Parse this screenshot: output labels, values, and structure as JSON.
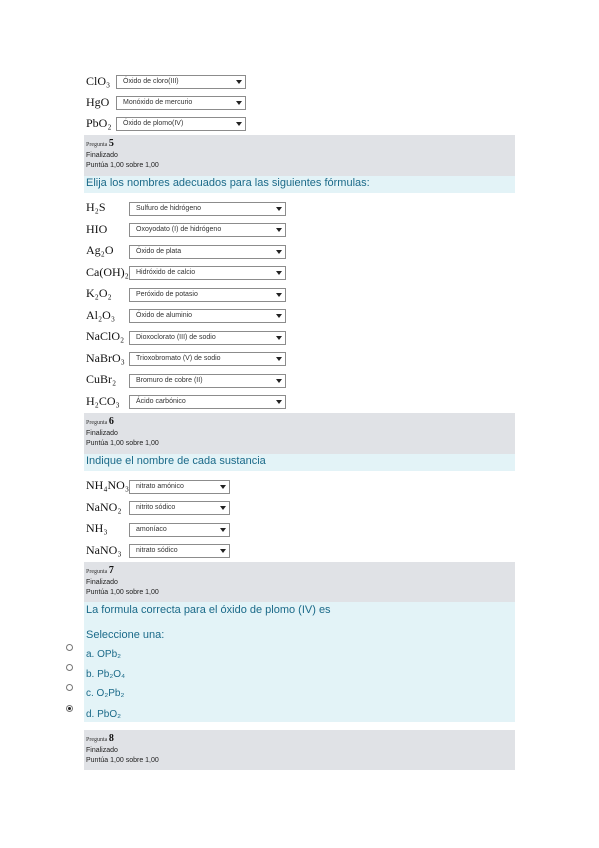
{
  "q4_rows": [
    {
      "formula": "ClO₃",
      "answer": "Óxido de cloro(III)"
    },
    {
      "formula": "HgO",
      "answer": "Monóxido de mercurio"
    },
    {
      "formula": "PbO₂",
      "answer": "Óxido de plomo(IV)"
    }
  ],
  "q5": {
    "pregunta_label": "Pregunta",
    "number": "5",
    "status": "Finalizado",
    "score": "Puntúa 1,00 sobre 1,00",
    "text": "Elija los nombres adecuados para las siguientes fórmulas:",
    "rows": [
      {
        "formula": "H₂S",
        "answer": "Sulfuro de hidrógeno"
      },
      {
        "formula": "HIO",
        "answer": "Oxoyodato (I) de hidrógeno"
      },
      {
        "formula": "Ag₂O",
        "answer": "Óxido de plata"
      },
      {
        "formula": "Ca(OH)₂",
        "answer": "Hidróxido de calcio"
      },
      {
        "formula": "K₂O₂",
        "answer": "Peróxido de potasio"
      },
      {
        "formula": "Al₂O₃",
        "answer": "Óxido de aluminio"
      },
      {
        "formula": "NaClO₂",
        "answer": "Dioxoclorato (III) de sodio"
      },
      {
        "formula": "NaBrO₃",
        "answer": "Trioxobromato (V) de sodio"
      },
      {
        "formula": "CuBr₂",
        "answer": "Bromuro de cobre (II)"
      },
      {
        "formula": "H₂CO₃",
        "answer": "Ácido carbónico"
      }
    ]
  },
  "q6": {
    "pregunta_label": "Pregunta",
    "number": "6",
    "status": "Finalizado",
    "score": "Puntúa 1,00 sobre 1,00",
    "text": "Indique el nombre de cada sustancia",
    "rows": [
      {
        "formula": "NH₄NO₃",
        "answer": "nitrato amónico"
      },
      {
        "formula": "NaNO₂",
        "answer": "nitrito sódico"
      },
      {
        "formula": "NH₃",
        "answer": "amoníaco"
      },
      {
        "formula": "NaNO₃",
        "answer": "nitrato sódico"
      }
    ]
  },
  "q7": {
    "pregunta_label": "Pregunta",
    "number": "7",
    "status": "Finalizado",
    "score": "Puntúa 1,00 sobre 1,00",
    "text": "La formula correcta para el óxido de plomo (IV) es",
    "prompt": "Seleccione una:",
    "options": [
      {
        "label": "a. OPb₂",
        "selected": false
      },
      {
        "label": "b. Pb₂O₄",
        "selected": false
      },
      {
        "label": "c. O₂Pb₂",
        "selected": false
      },
      {
        "label": "d. PbO₂",
        "selected": true
      }
    ]
  },
  "q8": {
    "pregunta_label": "Pregunta",
    "number": "8",
    "status": "Finalizado",
    "score": "Puntúa 1,00 sobre 1,00"
  }
}
